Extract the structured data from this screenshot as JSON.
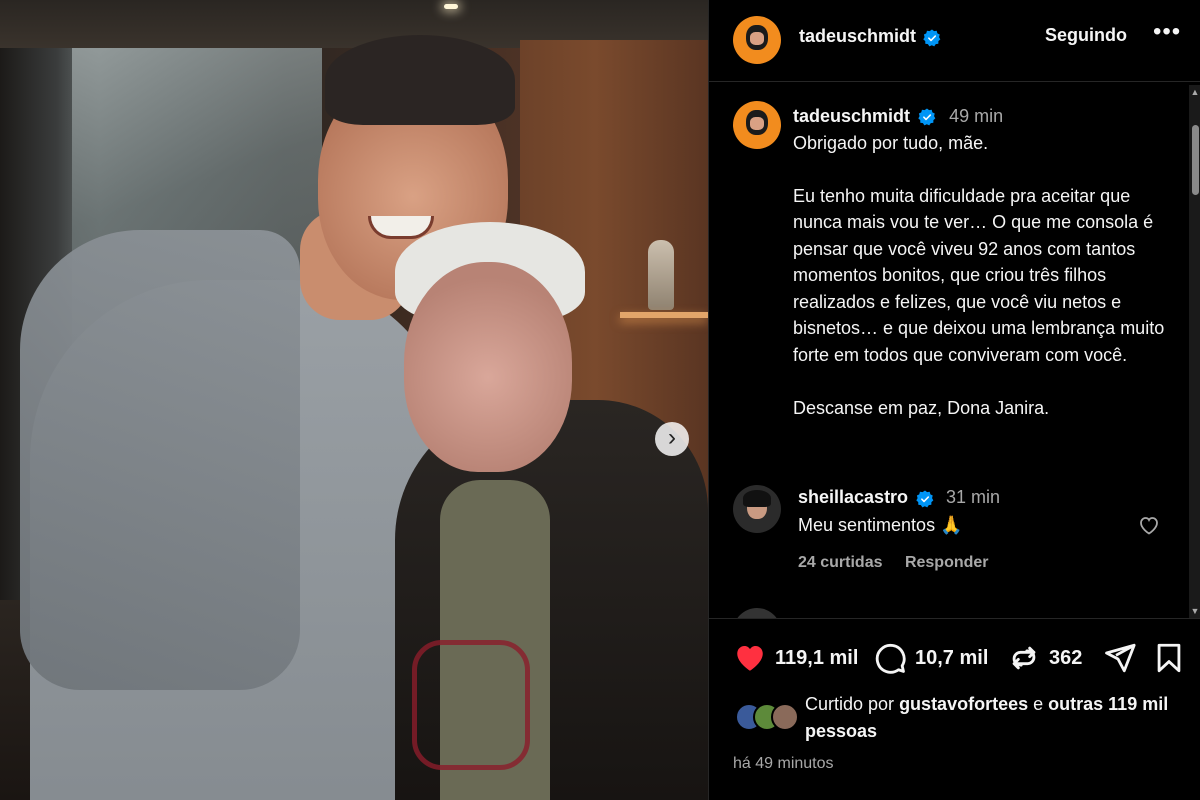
{
  "photo": {
    "next_icon": "chevron-right-icon",
    "next_symbol": "›"
  },
  "header": {
    "username": "tadeuschmidt",
    "follow_label": "Seguindo",
    "more_label": "•••"
  },
  "caption": {
    "username": "tadeuschmidt",
    "time": "49 min",
    "paragraphs": [
      "Obrigado por tudo, mãe.",
      "Eu tenho muita dificuldade pra aceitar que nunca mais vou te ver… O que me consola é pensar que você viveu 92 anos com tantos momentos bonitos, que criou três filhos realizados e felizes, que você viu netos e bisnetos… e que deixou uma lembrança muito forte em todos que conviveram com você.",
      "Descanse em paz, Dona Janira."
    ]
  },
  "comment": {
    "username": "sheillacastro",
    "time": "31 min",
    "text": "Meu sentimentos 🙏",
    "likes": "24 curtidas",
    "reply_label": "Responder"
  },
  "actions": {
    "likes": "119,1 mil",
    "comments": "10,7 mil",
    "reposts": "362",
    "like_color": "#ff3040"
  },
  "liked_by": {
    "prefix": "Curtido por",
    "user": "gustavofortees",
    "conjunction": "e",
    "others": "outras 119 mil pessoas"
  },
  "post_time": "há 49 minutos",
  "colors": {
    "verified": "#0095f6",
    "avatar_bg": "#f28c1e"
  }
}
